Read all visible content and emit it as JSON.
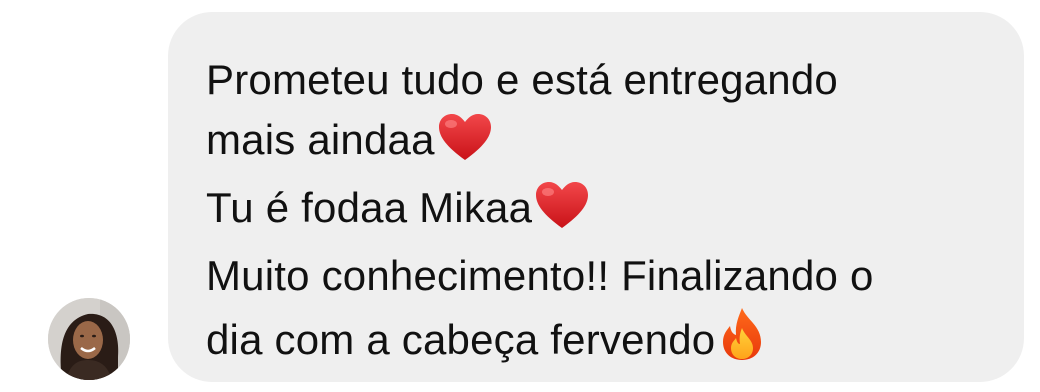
{
  "message": {
    "lines": [
      {
        "text": "Prometeu tudo e está entregando",
        "emoji": null
      },
      {
        "text": "mais aindaa",
        "emoji": "heart-icon"
      },
      {
        "text": "Tu é fodaa Mikaa",
        "emoji": "heart-icon"
      },
      {
        "text": "Muito conhecimento!! Finalizando o",
        "emoji": null
      },
      {
        "text": "dia  com a cabeça fervendo",
        "emoji": "fire-icon"
      }
    ]
  },
  "colors": {
    "bubble": "#efefef",
    "text": "#111111",
    "heart": "#e0201f",
    "fire": "#f78b1f"
  }
}
